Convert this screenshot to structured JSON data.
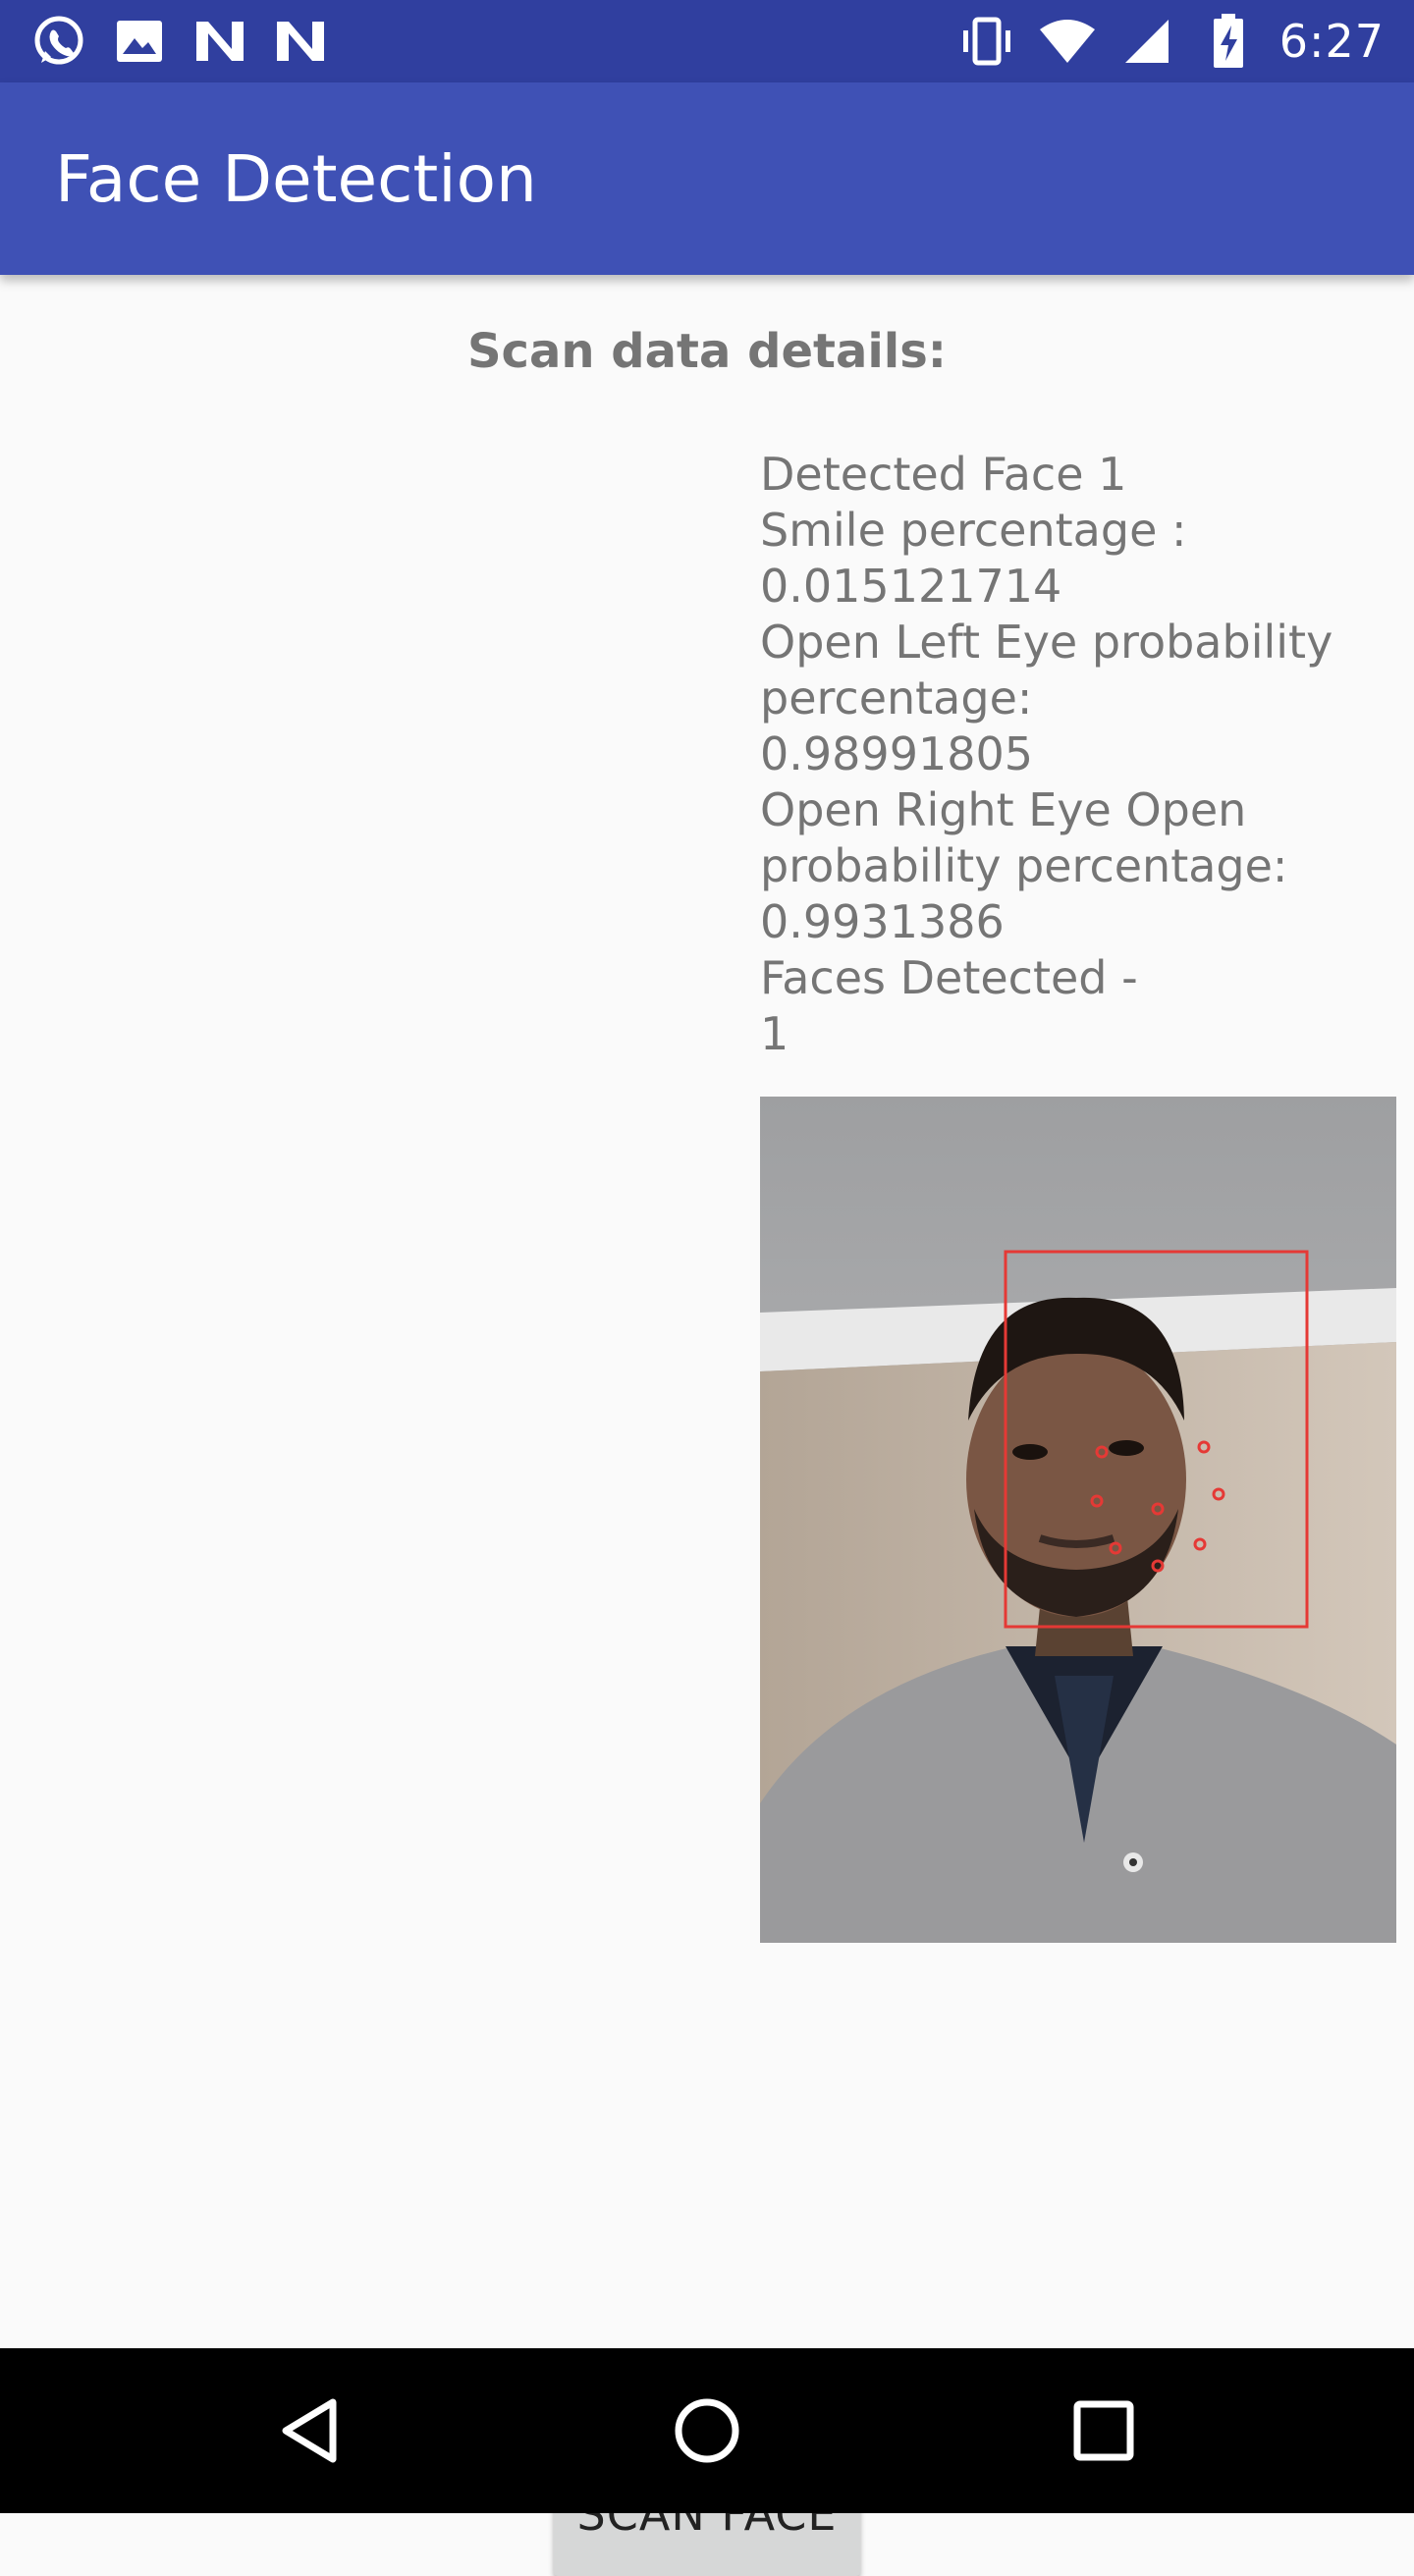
{
  "status_bar": {
    "time": "6:27",
    "left_icons": [
      "whatsapp-icon",
      "gallery-icon",
      "n-notification-icon",
      "n-notification-icon"
    ],
    "right_icons": [
      "vibrate-icon",
      "wifi-icon",
      "cell-signal-icon",
      "battery-charging-icon"
    ]
  },
  "app_bar": {
    "title": "Face Detection"
  },
  "scan": {
    "heading": "Scan data details:",
    "details": "Detected Face 1\nSmile percentage :\n0.015121714\nOpen Left Eye probability\npercentage:\n0.98991805\nOpen Right Eye Open\nprobability percentage:\n0.9931386\nFaces Detected -\n1"
  },
  "photo": {
    "image": "face-photo-with-detection-box",
    "box_color": "#e53935"
  },
  "button": {
    "label": "SCAN FACE"
  },
  "nav_bar": {
    "icons": [
      "back-icon",
      "home-icon",
      "recents-icon"
    ]
  }
}
